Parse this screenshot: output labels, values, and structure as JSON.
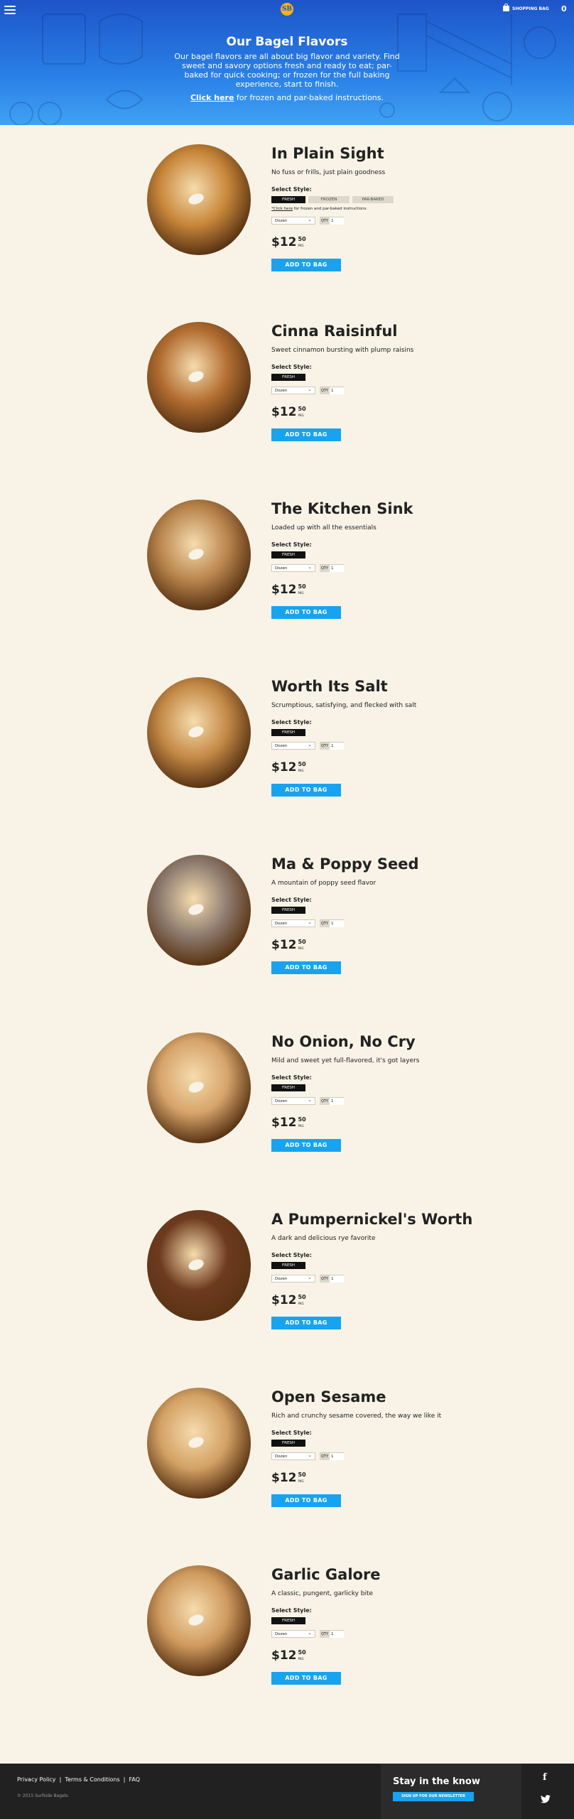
{
  "header": {
    "logo_text": "SB",
    "shopping_bag_label": "SHOPPING BAG",
    "bag_count": "0",
    "title": "Our Bagel Flavors",
    "description": "Our bagel flavors are all about big flavor and variety.  Find sweet and savory options fresh and ready to eat; par-baked for quick cooking; or frozen for the full baking experience, start to finish.",
    "link_text": "Click here",
    "link_suffix": " for frozen and par-baked instructions."
  },
  "common": {
    "select_style_label": "Select Style:",
    "size_option": "Dozen",
    "qty_label": "QTY",
    "qty_value": "1",
    "price_main": "$12",
    "price_cents": "50",
    "price_unit": "PKG",
    "add_button": "ADD TO BAG",
    "note_link": "*Click here",
    "note_suffix": " for frozen and par-baked instructions."
  },
  "products": [
    {
      "name": "In Plain Sight",
      "description": "No fuss or frills, just plain goodness",
      "styles": [
        "FRESH",
        "FROZEN",
        "PAR-BAKED"
      ],
      "color": "#c8873a"
    },
    {
      "name": "Cinna Raisinful",
      "description": "Sweet cinnamon bursting with plump raisins",
      "styles": [
        "FRESH"
      ],
      "color": "#b36e31"
    },
    {
      "name": "The Kitchen Sink",
      "description": "Loaded up with all the essentials",
      "styles": [
        "FRESH"
      ],
      "color": "#b9854d"
    },
    {
      "name": "Worth Its Salt",
      "description": "Scrumptious, satisfying, and flecked with salt",
      "styles": [
        "FRESH"
      ],
      "color": "#c48946"
    },
    {
      "name": "Ma & Poppy Seed",
      "description": "A mountain of poppy seed flavor",
      "styles": [
        "FRESH"
      ],
      "color": "#8e7c70"
    },
    {
      "name": "No Onion, No Cry",
      "description": "Mild and sweet yet full-flavored, it's got layers",
      "styles": [
        "FRESH"
      ],
      "color": "#d6a46b"
    },
    {
      "name": "A Pumpernickel's Worth",
      "description": "A dark and delicious rye favorite",
      "styles": [
        "FRESH"
      ],
      "color": "#6e3a1f"
    },
    {
      "name": "Open Sesame",
      "description": "Rich and crunchy sesame covered, the way we like it",
      "styles": [
        "FRESH"
      ],
      "color": "#d3a164"
    },
    {
      "name": "Garlic Galore",
      "description": "A classic, pungent, garlicky bite",
      "styles": [
        "FRESH"
      ],
      "color": "#cf9a5e"
    }
  ],
  "footer": {
    "links": [
      "Privacy Policy",
      "Terms & Conditions",
      "FAQ"
    ],
    "separator": "|",
    "copyright": "© 2015 Surfside Bagels.",
    "newsletter_title": "Stay in the know",
    "newsletter_button": "SIGN UP FOR OUR NEWSLETTER",
    "facebook_glyph": "f"
  }
}
